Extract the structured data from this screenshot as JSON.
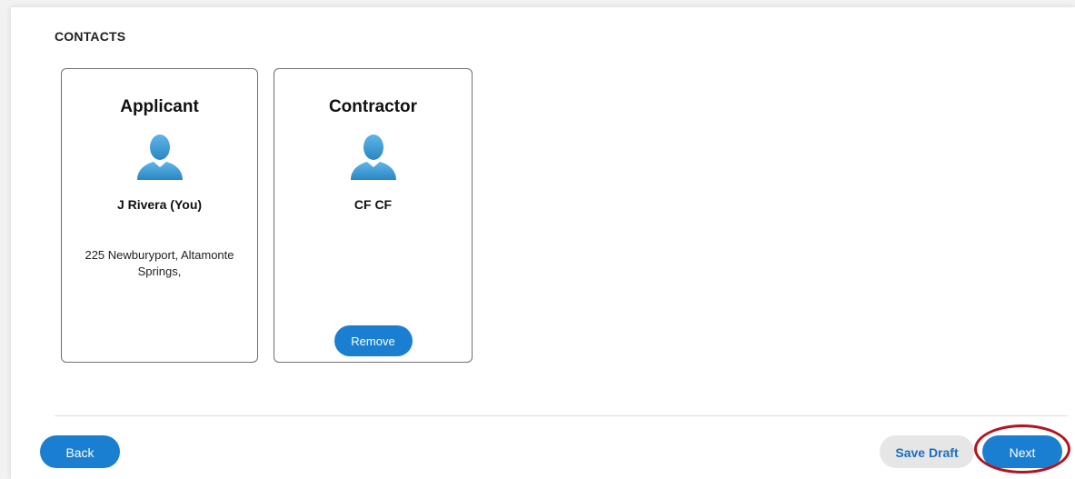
{
  "section": {
    "title": "CONTACTS"
  },
  "contacts": [
    {
      "role": "Applicant",
      "name": "J Rivera (You)",
      "address": "225 Newburyport, Altamonte Springs,",
      "avatar_icon": "user-avatar-icon"
    },
    {
      "role": "Contractor",
      "name": "CF CF",
      "remove_label": "Remove",
      "avatar_icon": "user-avatar-icon"
    }
  ],
  "footer": {
    "back_label": "Back",
    "save_draft_label": "Save Draft",
    "next_label": "Next"
  },
  "colors": {
    "primary": "#1a7fd0",
    "avatar": "#3a9fd6",
    "highlight": "#b3141f",
    "secondary_button_bg": "#e6e6e6"
  }
}
